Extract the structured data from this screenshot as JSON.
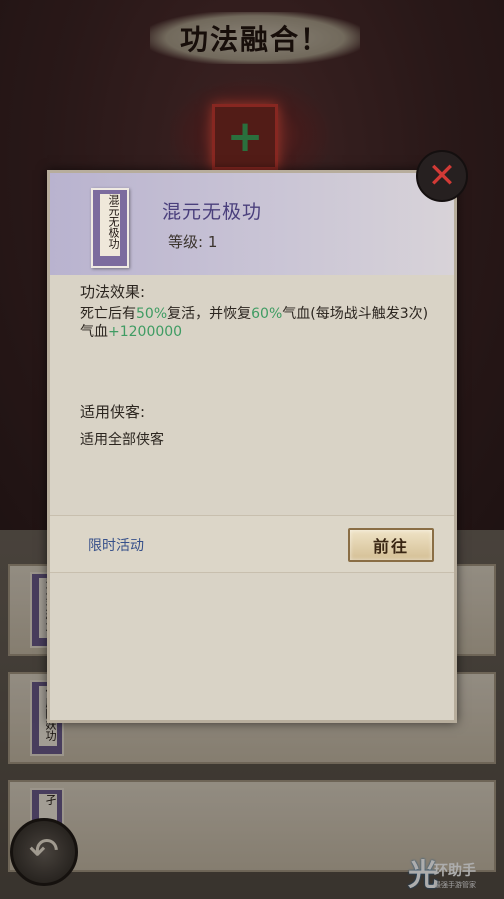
{
  "header": {
    "title": "功法融合！"
  },
  "background_list": [
    {
      "book_label": "混元无极功"
    },
    {
      "book_label": "伏魔降妖功"
    },
    {
      "book_label": "孑"
    }
  ],
  "skill_popup": {
    "book_label": "混元无极功",
    "name": "混元无极功",
    "level_text": "等级: 1",
    "effect_heading": "功法效果:",
    "effect_line1_before": "死亡后有",
    "effect_pct1": "50%",
    "effect_line1_mid": "复活，并恢复",
    "effect_pct2": "60%",
    "effect_line1_after": "气血(每场战斗触发3次)",
    "effect_line2_prefix": "气血",
    "effect_line2_value": "+1200000",
    "applicable_heading": "适用侠客:",
    "applicable_text": "适用全部侠客",
    "activity_label": "限时活动",
    "go_button_label": "前往"
  },
  "watermark": {
    "title": "环助手",
    "subtitle": "最强手游管家"
  },
  "colors": {
    "highlight_green": "#3f9c63",
    "accent_purple": "#4a3f7c",
    "link_blue": "#36508a",
    "close_red": "#d23a36"
  },
  "icons": {
    "close": "close-icon",
    "back": "back-arrow-icon",
    "plus": "plus-icon"
  }
}
